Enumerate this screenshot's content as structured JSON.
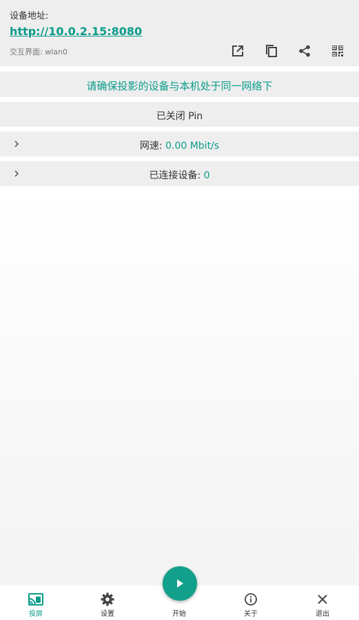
{
  "address": {
    "label": "设备地址:",
    "url": "http://10.0.2.15:8080",
    "interface": "交互界面: wlan0",
    "actions": [
      "open-external-icon",
      "copy-icon",
      "share-icon",
      "qr-code-icon"
    ]
  },
  "notice": "请确保投影的设备与本机处于同一网络下",
  "pin_status": "已关闭 Pin",
  "speed": {
    "label": "网速: ",
    "value": "0.00 Mbit/s"
  },
  "clients": {
    "label": "已连接设备: ",
    "value": "0"
  },
  "nav": {
    "cast": "投屏",
    "settings": "设置",
    "start": "开始",
    "about": "关于",
    "exit": "退出"
  },
  "colors": {
    "accent": "#0b9c8a",
    "fab": "#13a08b",
    "card": "#eeeeee"
  }
}
